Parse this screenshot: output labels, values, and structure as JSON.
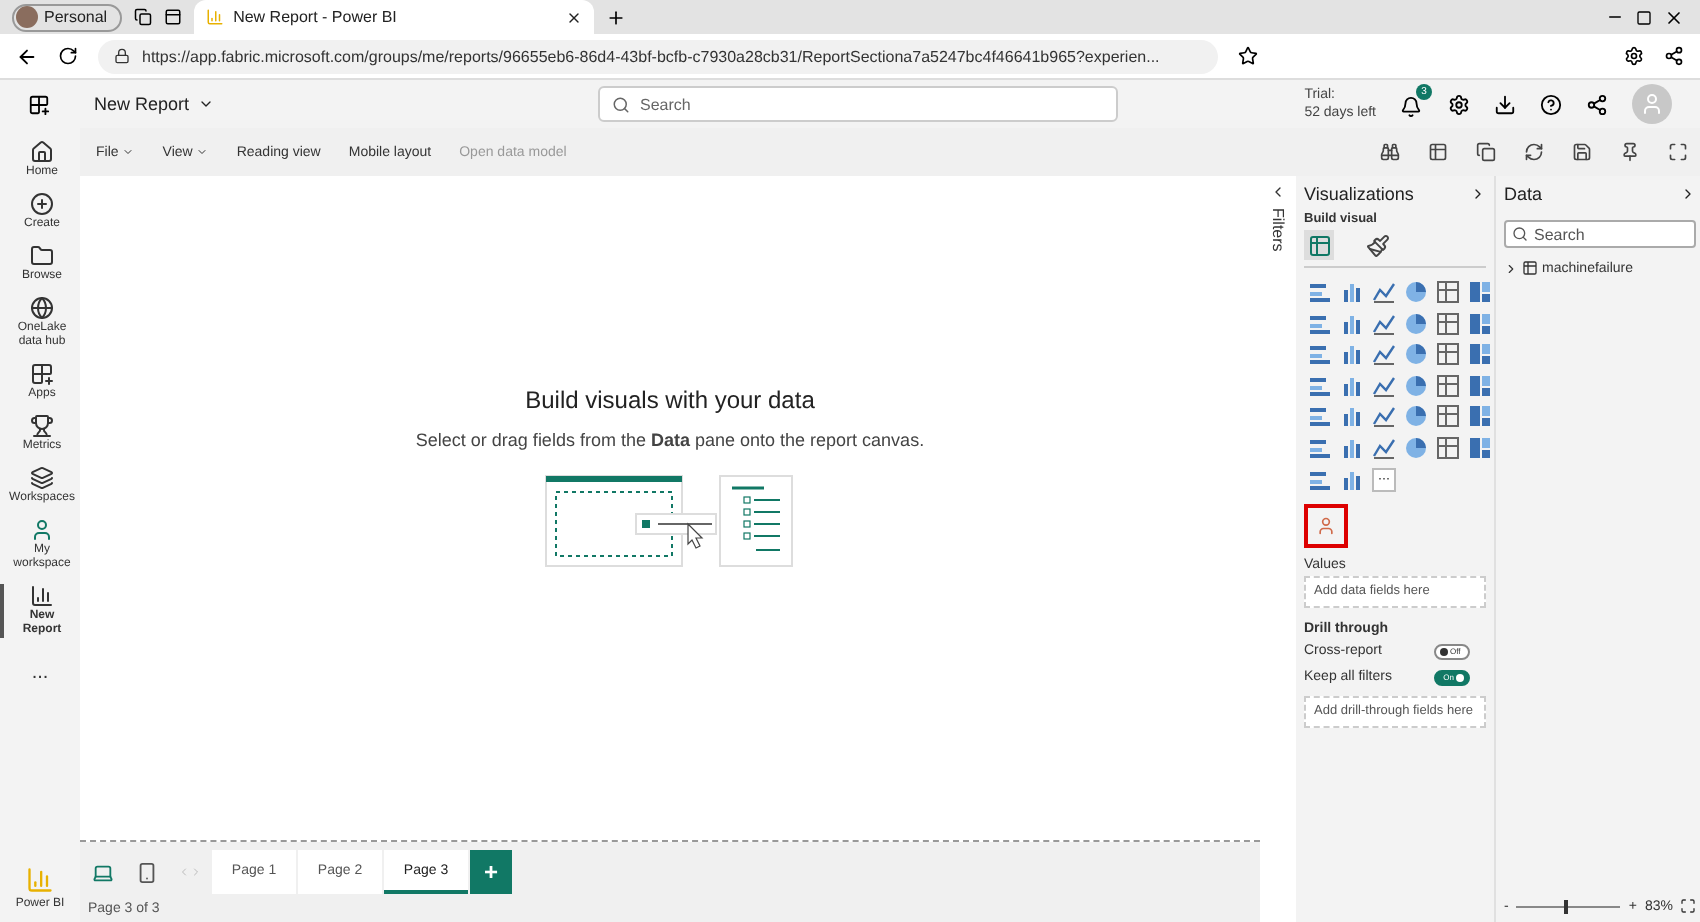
{
  "browser": {
    "profile": "Personal",
    "tabs": [
      {
        "title": "New Report - Power BI",
        "selected": true
      }
    ],
    "url": "https://app.fabric.microsoft.com/groups/me/reports/96655eb6-86d4-43bf-bcfb-c7930a28cb31/ReportSectiona7a5247bc4f46641b965?experien..."
  },
  "header": {
    "title": "New Report",
    "search": {
      "placeholder": "Search"
    },
    "trial": "Trial:",
    "trial_days": "52 days left",
    "notifications": "3"
  },
  "nav": [
    {
      "label": "Home",
      "selected": false
    },
    {
      "label": "Create",
      "selected": false
    },
    {
      "label": "Browse",
      "selected": false
    },
    {
      "label": "OneLake data hub",
      "selected": false
    },
    {
      "label": "Apps",
      "selected": false
    },
    {
      "label": "Metrics",
      "selected": false
    },
    {
      "label": "Workspaces",
      "selected": false
    },
    {
      "label": "My workspace",
      "selected": false
    },
    {
      "label": "New Report",
      "selected": true
    }
  ],
  "nav_more": "...",
  "brand": "Power BI",
  "toolbar": [
    {
      "label": "File",
      "dropdown": true,
      "disabled": false
    },
    {
      "label": "View",
      "dropdown": true,
      "disabled": false
    },
    {
      "label": "Reading view",
      "dropdown": false,
      "disabled": false
    },
    {
      "label": "Mobile layout",
      "dropdown": false,
      "disabled": false
    },
    {
      "label": "Open data model",
      "dropdown": false,
      "disabled": true
    }
  ],
  "canvas": {
    "title": "Build visuals with your data",
    "hint": "Select or drag fields from the **Data** pane onto the report canvas."
  },
  "pages": [
    {
      "label": "Page 1",
      "selected": false
    },
    {
      "label": "Page 2",
      "selected": false
    },
    {
      "label": "Page 3",
      "selected": true
    }
  ],
  "add_page": "+",
  "status": {
    "page_info": "Page 3 of 3",
    "zoom": "83%",
    "level": 0.45,
    "minus": "-",
    "plus": "+"
  },
  "filters": {
    "label": "Filters"
  },
  "visualizations": {
    "title": "Visualizations",
    "subtitle": "Build visual",
    "build_tabs": [
      {
        "selected": true
      },
      {
        "selected": false
      }
    ],
    "more": "···",
    "custom_highlighted": true,
    "values_label": "Values",
    "values_placeholder": "Add data fields here",
    "drill_title": "Drill through",
    "toggles": [
      {
        "label": "Cross-report",
        "on": false,
        "state_text": "Off"
      },
      {
        "label": "Keep all filters",
        "on": true,
        "state_text": "On"
      }
    ],
    "drill_placeholder": "Add drill-through fields here"
  },
  "data": {
    "title": "Data",
    "search": {
      "placeholder": "Search"
    },
    "tables": [
      {
        "name": "machinefailure",
        "expanded": false
      }
    ]
  }
}
